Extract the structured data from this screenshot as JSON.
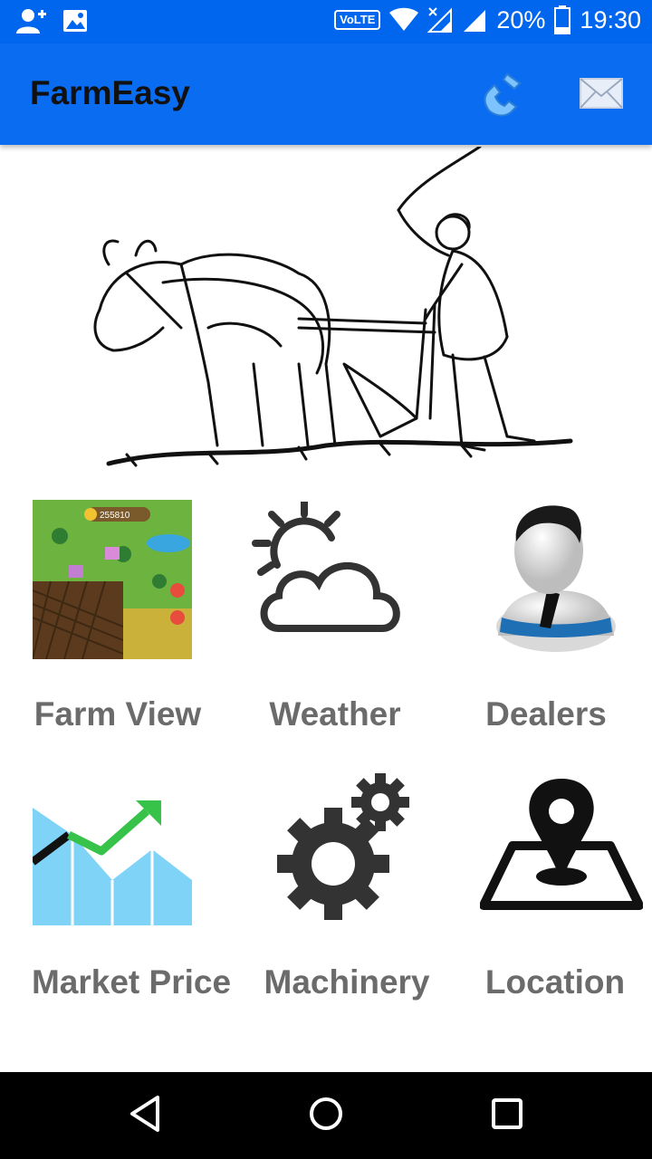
{
  "status_bar": {
    "volte": "VoLTE",
    "battery": "20%",
    "time": "19:30",
    "icons": [
      "add-user-icon",
      "image-icon",
      "wifi-icon",
      "signal-x-icon",
      "signal-icon",
      "battery-icon"
    ]
  },
  "app_bar": {
    "title": "FarmEasy",
    "actions": [
      "phone-icon",
      "mail-icon"
    ],
    "color": "#0a6cf0"
  },
  "hero": {
    "description_icon": "farmer-plough-illustration"
  },
  "tiles": [
    {
      "id": "farm-view",
      "label": "Farm View",
      "icon": "farm-game-thumbnail"
    },
    {
      "id": "weather",
      "label": "Weather",
      "icon": "sun-cloud-icon"
    },
    {
      "id": "dealers",
      "label": "Dealers",
      "icon": "dealer-person-icon"
    },
    {
      "id": "market-price",
      "label": "Market Price",
      "icon": "market-chart-icon"
    },
    {
      "id": "machinery",
      "label": "Machinery",
      "icon": "gears-icon"
    },
    {
      "id": "location",
      "label": "Location",
      "icon": "map-pin-icon"
    }
  ],
  "farm_thumbnail": {
    "coins": "255810"
  },
  "nav": [
    "back-icon",
    "home-icon",
    "recents-icon"
  ]
}
